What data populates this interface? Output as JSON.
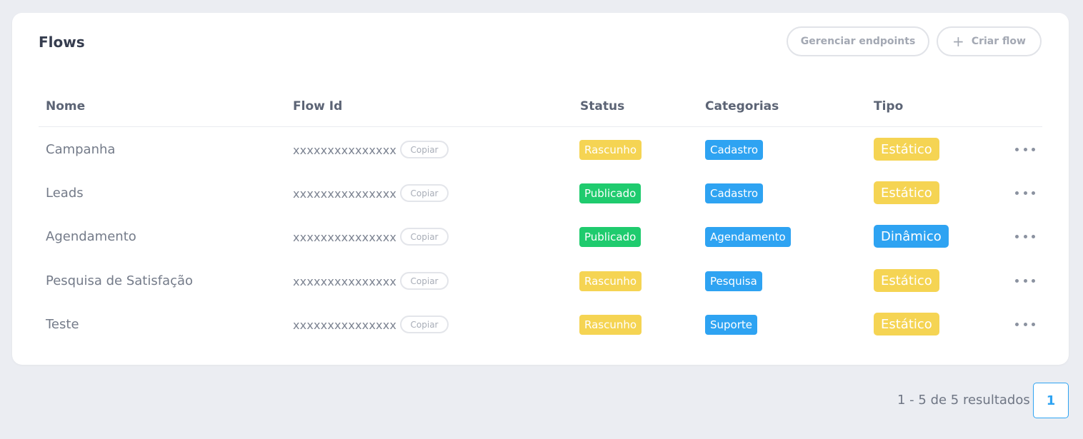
{
  "header": {
    "title": "Flows",
    "manage_endpoints_label": "Gerenciar endpoints",
    "create_flow_label": "Criar flow"
  },
  "table": {
    "columns": [
      "Nome",
      "Flow Id",
      "Status",
      "Categorias",
      "Tipo"
    ],
    "copy_label": "Copiar",
    "rows": [
      {
        "name": "Campanha",
        "flow_id": "xxxxxxxxxxxxxxx",
        "status": "Rascunho",
        "category": "Cadastro",
        "type": "Estático"
      },
      {
        "name": "Leads",
        "flow_id": "xxxxxxxxxxxxxxx",
        "status": "Publicado",
        "category": "Cadastro",
        "type": "Estático"
      },
      {
        "name": "Agendamento",
        "flow_id": "xxxxxxxxxxxxxxx",
        "status": "Publicado",
        "category": "Agendamento",
        "type": "Dinâmico"
      },
      {
        "name": "Pesquisa de Satisfação",
        "flow_id": "xxxxxxxxxxxxxxx",
        "status": "Rascunho",
        "category": "Pesquisa",
        "type": "Estático"
      },
      {
        "name": "Teste",
        "flow_id": "xxxxxxxxxxxxxxx",
        "status": "Rascunho",
        "category": "Suporte",
        "type": "Estático"
      }
    ]
  },
  "pagination": {
    "results_text": "1 - 5 de 5 resultados",
    "current_page": "1"
  },
  "colors": {
    "rascunho": "#f5d453",
    "publicado": "#1fcb6e",
    "category": "#2ea3f2",
    "estatico": "#f5d453",
    "dinamico": "#2ea3f2",
    "accent": "#2ea3f2"
  },
  "icons": {
    "create_flow": "plus-icon",
    "row_menu": "more-horizontal-icon"
  }
}
